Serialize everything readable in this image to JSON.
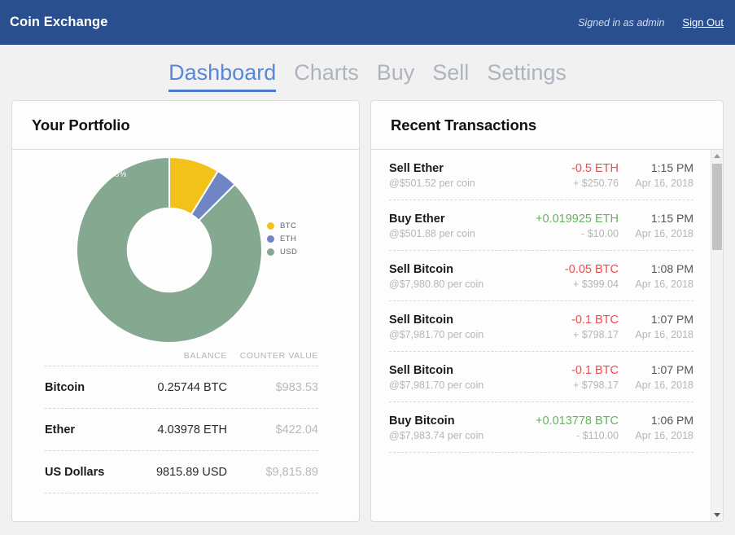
{
  "header": {
    "brand": "Coin Exchange",
    "signed_in": "Signed in as admin",
    "sign_out": "Sign Out",
    "bg_color": "#2a4f8f"
  },
  "nav": {
    "tabs": [
      {
        "label": "Dashboard",
        "active": true
      },
      {
        "label": "Charts",
        "active": false
      },
      {
        "label": "Buy",
        "active": false
      },
      {
        "label": "Sell",
        "active": false
      },
      {
        "label": "Settings",
        "active": false
      }
    ],
    "active_color": "#5b86d6",
    "inactive_color": "#adb4bd"
  },
  "portfolio": {
    "title": "Your Portfolio",
    "chart_data": {
      "type": "pie",
      "title": "",
      "categories": [
        "BTC",
        "ETH",
        "USD"
      ],
      "values": [
        8.8,
        3.7,
        87.5
      ],
      "value_labels": [
        "8.8%",
        "",
        "87.5%"
      ],
      "colors": [
        "#f3c21a",
        "#6f85c4",
        "#84a890"
      ],
      "legend": [
        "BTC",
        "ETH",
        "USD"
      ],
      "legend_position": "right",
      "donut_hole": 0.45,
      "start_angle": 0,
      "units": "percent"
    },
    "table": {
      "headers": [
        "",
        "BALANCE",
        "COUNTER VALUE"
      ],
      "rows": [
        {
          "name": "Bitcoin",
          "balance": "0.25744 BTC",
          "counter_value": "$983.53"
        },
        {
          "name": "Ether",
          "balance": "4.03978 ETH",
          "counter_value": "$422.04"
        },
        {
          "name": "US Dollars",
          "balance": "9815.89 USD",
          "counter_value": "$9,815.89"
        }
      ]
    }
  },
  "transactions": {
    "title": "Recent Transactions",
    "positive_color": "#66b35f",
    "negative_color": "#ef4b4b",
    "rows": [
      {
        "title": "Sell Ether",
        "rate": "@$501.52 per coin",
        "amount": "-0.5 ETH",
        "sign": "neg",
        "fiat": "+ $250.76",
        "time": "1:15 PM",
        "date": "Apr 16, 2018"
      },
      {
        "title": "Buy Ether",
        "rate": "@$501.88 per coin",
        "amount": "+0.019925 ETH",
        "sign": "pos",
        "fiat": "- $10.00",
        "time": "1:15 PM",
        "date": "Apr 16, 2018"
      },
      {
        "title": "Sell Bitcoin",
        "rate": "@$7,980.80 per coin",
        "amount": "-0.05 BTC",
        "sign": "neg",
        "fiat": "+ $399.04",
        "time": "1:08 PM",
        "date": "Apr 16, 2018"
      },
      {
        "title": "Sell Bitcoin",
        "rate": "@$7,981.70 per coin",
        "amount": "-0.1 BTC",
        "sign": "neg",
        "fiat": "+ $798.17",
        "time": "1:07 PM",
        "date": "Apr 16, 2018"
      },
      {
        "title": "Sell Bitcoin",
        "rate": "@$7,981.70 per coin",
        "amount": "-0.1 BTC",
        "sign": "neg",
        "fiat": "+ $798.17",
        "time": "1:07 PM",
        "date": "Apr 16, 2018"
      },
      {
        "title": "Buy Bitcoin",
        "rate": "@$7,983.74 per coin",
        "amount": "+0.013778 BTC",
        "sign": "pos",
        "fiat": "- $110.00",
        "time": "1:06 PM",
        "date": "Apr 16, 2018"
      }
    ]
  }
}
